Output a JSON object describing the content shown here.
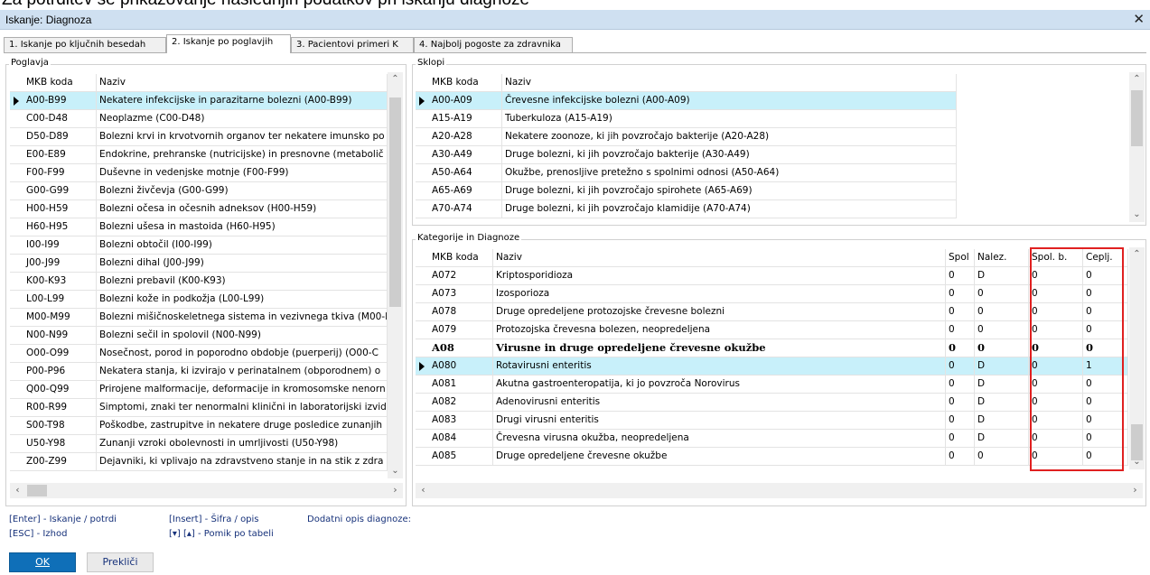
{
  "caption": "Za potrditev še prikazovanje naslednjih podatkov pri iskanju diagnoze",
  "window": {
    "title": "Iskanje: Diagnoza",
    "close": "✕"
  },
  "tabs": [
    "1. Iskanje po ključnih besedah",
    "2. Iskanje po poglavjih",
    "3. Pacientovi primeri K",
    "4. Najbolj pogoste za zdravnika"
  ],
  "poglavja": {
    "title": "Poglavja",
    "headers": [
      "MKB koda",
      "Naziv"
    ],
    "rows": [
      [
        "A00-B99",
        "Nekatere infekcijske in parazitarne bolezni (A00-B99)"
      ],
      [
        "C00-D48",
        "Neoplazme (C00-D48)"
      ],
      [
        "D50-D89",
        "Bolezni krvi in krvotvornih organov ter nekatere imunsko po"
      ],
      [
        "E00-E89",
        "Endokrine, prehranske (nutricijske) in presnovne (metabolič"
      ],
      [
        "F00-F99",
        "Duševne in vedenjske motnje (F00-F99)"
      ],
      [
        "G00-G99",
        "Bolezni živčevja (G00-G99)"
      ],
      [
        "H00-H59",
        "Bolezni očesa in očesnih adneksov (H00-H59)"
      ],
      [
        "H60-H95",
        "Bolezni ušesa in mastoida (H60-H95)"
      ],
      [
        "I00-I99",
        "Bolezni obtočil (I00-I99)"
      ],
      [
        "J00-J99",
        "Bolezni dihal (J00-J99)"
      ],
      [
        "K00-K93",
        "Bolezni prebavil (K00-K93)"
      ],
      [
        "L00-L99",
        "Bolezni kože in podkožja (L00-L99)"
      ],
      [
        "M00-M99",
        "Bolezni mišičnoskeletnega sistema in vezivnega tkiva (M00-I"
      ],
      [
        "N00-N99",
        "Bolezni sečil in spolovil (N00-N99)"
      ],
      [
        "O00-O99",
        "Nosečnost, porod in poporodno obdobje (puerperij) (O00-C"
      ],
      [
        "P00-P96",
        "Nekatera stanja, ki izvirajo v perinatalnem (obporodnem) o"
      ],
      [
        "Q00-Q99",
        "Prirojene malformacije, deformacije in kromosomske nenorn"
      ],
      [
        "R00-R99",
        "Simptomi, znaki ter nenormalni klinični in laboratorijski izvidi,"
      ],
      [
        "S00-T98",
        "Poškodbe, zastrupitve in nekatere druge posledice zunanjih"
      ],
      [
        "U50-Y98",
        "Zunanji vzroki obolevnosti in umrljivosti (U50-Y98)"
      ],
      [
        "Z00-Z99",
        "Dejavniki, ki vplivajo na zdravstveno stanje in na stik z zdra"
      ]
    ]
  },
  "sklopi": {
    "title": "Sklopi",
    "headers": [
      "MKB koda",
      "Naziv"
    ],
    "rows": [
      [
        "A00-A09",
        "Črevesne infekcijske bolezni (A00-A09)"
      ],
      [
        "A15-A19",
        "Tuberkuloza (A15-A19)"
      ],
      [
        "A20-A28",
        "Nekatere zoonoze, ki jih povzročajo bakterije (A20-A28)"
      ],
      [
        "A30-A49",
        "Druge bolezni, ki jih povzročajo bakterije (A30-A49)"
      ],
      [
        "A50-A64",
        "Okužbe, prenosljive pretežno s spolnimi odnosi (A50-A64)"
      ],
      [
        "A65-A69",
        "Druge bolezni, ki jih povzročajo spirohete (A65-A69)"
      ],
      [
        "A70-A74",
        "Druge bolezni, ki jih povzročajo klamidije (A70-A74)"
      ]
    ]
  },
  "kategorije": {
    "title": "Kategorije in Diagnoze",
    "headers": [
      "MKB koda",
      "Naziv",
      "Spol",
      "Nalez.",
      "Spol. b.",
      "Ceplj."
    ],
    "rows": [
      [
        "A072",
        "Kriptosporidioza",
        "0",
        "D",
        "0",
        "0"
      ],
      [
        "A073",
        "Izosporioza",
        "0",
        "0",
        "0",
        "0"
      ],
      [
        "A078",
        "Druge opredeljene protozojske črevesne bolezni",
        "0",
        "0",
        "0",
        "0"
      ],
      [
        "A079",
        "Protozojska črevesna bolezen, neopredeljena",
        "0",
        "0",
        "0",
        "0"
      ],
      [
        "A08",
        "Virusne in druge opredeljene črevesne okužbe",
        "0",
        "0",
        "0",
        "0"
      ],
      [
        "A080",
        "Rotavirusni enteritis",
        "0",
        "D",
        "0",
        "1"
      ],
      [
        "A081",
        "Akutna gastroenteropatija, ki jo povzroča Norovirus",
        "0",
        "D",
        "0",
        "0"
      ],
      [
        "A082",
        "Adenovirusni enteritis",
        "0",
        "D",
        "0",
        "0"
      ],
      [
        "A083",
        "Drugi virusni enteritis",
        "0",
        "D",
        "0",
        "0"
      ],
      [
        "A084",
        "Črevesna virusna okužba, neopredeljena",
        "0",
        "D",
        "0",
        "0"
      ],
      [
        "A085",
        "Druge opredeljene črevesne okužbe",
        "0",
        "0",
        "0",
        "0"
      ]
    ]
  },
  "help": {
    "enter": "[Enter] - Iskanje / potrdi",
    "esc": "[ESC] - Izhod",
    "insert": "[Insert] - Šifra / opis",
    "arrows": "[▾] [▴] - Pomik po tabeli",
    "dodatni": "Dodatni opis diagnoze:"
  },
  "buttons": {
    "ok": "OK",
    "cancel": "Prekliči"
  },
  "colors": {
    "selected_row": "#c8f0fa",
    "highlight_box": "#e02020",
    "ok_button": "#0f6fb8"
  }
}
